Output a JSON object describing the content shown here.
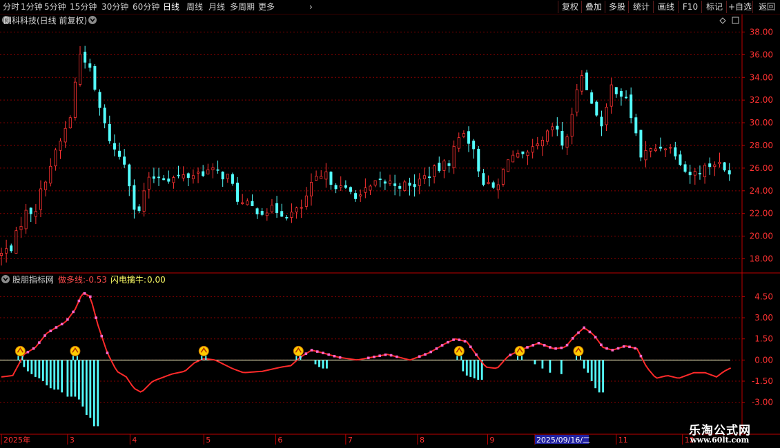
{
  "toolbar": {
    "periods": [
      "分时",
      "1分钟",
      "5分钟",
      "15分钟",
      "30分钟",
      "60分钟",
      "日线",
      "周线",
      "月线",
      "多周期",
      "更多"
    ],
    "active_period": "日线",
    "more_arrow": "›",
    "buttons": [
      "复权",
      "叠加",
      "多股",
      "统计",
      "画线",
      "F10",
      "标记",
      "+自选",
      "返回"
    ]
  },
  "main_panel": {
    "title": "朗科科技(日线 前复权)",
    "collapse_icon": "chevron-down-icon",
    "diamond_icon": "diamond-icon",
    "y_labels": [
      "38.00",
      "36.00",
      "34.00",
      "32.00",
      "30.00",
      "28.00",
      "26.00",
      "24.00",
      "22.00",
      "20.00",
      "18.00"
    ]
  },
  "indicator_panel": {
    "name": "股朋指标网",
    "line1_label": "做多线",
    "line1_value": "-0.53",
    "line2_label": "闪电擒牛",
    "line2_value": "0.00",
    "y_labels": [
      "4.50",
      "3.00",
      "1.50",
      "0.00",
      "-1.50",
      "-3.00"
    ]
  },
  "x_axis": {
    "labels": [
      "2025年",
      "3",
      "4",
      "5",
      "6",
      "7",
      "8",
      "9",
      "2025/09/16/二",
      "11",
      "12"
    ]
  },
  "watermark": {
    "line1": "乐淘公式网",
    "line2": "www.60lt.com"
  },
  "colors": {
    "up": "#ff3232",
    "down": "#54ffff",
    "grid": "#8a0000",
    "axis": "#c00000",
    "signal_line": "#ff2a2a",
    "signal_dot": "#ff66cc",
    "zero_line": "#ffffcc",
    "signal_icon": "#ffcc00",
    "label_red": "#ff4a4a",
    "label_yellow": "#ffff66"
  },
  "chart_data": [
    {
      "type": "candlestick",
      "title": "朗科科技(日线 前复权)",
      "ylim": [
        17,
        39
      ],
      "y_ticks": [
        18,
        20,
        22,
        24,
        26,
        28,
        30,
        32,
        34,
        36,
        38
      ],
      "x_ticks": [
        "2025年",
        "3",
        "4",
        "5",
        "6",
        "7",
        "8",
        "9",
        "2025/09/16/二",
        "11",
        "12"
      ],
      "x_tick_days": [
        0,
        35,
        68,
        107,
        145,
        182,
        220,
        257,
        282,
        325,
        360
      ],
      "anchors": [
        {
          "day": 0,
          "close": 18.4
        },
        {
          "day": 6,
          "close": 19.2
        },
        {
          "day": 12,
          "close": 22.0
        },
        {
          "day": 18,
          "close": 22.4
        },
        {
          "day": 24,
          "close": 25.5
        },
        {
          "day": 30,
          "close": 27.8
        },
        {
          "day": 34,
          "close": 29.5
        },
        {
          "day": 37,
          "close": 30.8
        },
        {
          "day": 38,
          "close": 29.0
        },
        {
          "day": 39,
          "close": 33.5
        },
        {
          "day": 42,
          "close": 36.5
        },
        {
          "day": 46,
          "close": 35.0
        },
        {
          "day": 51,
          "close": 31.8
        },
        {
          "day": 55,
          "close": 29.5
        },
        {
          "day": 60,
          "close": 27.5
        },
        {
          "day": 66,
          "close": 26.4
        },
        {
          "day": 70,
          "close": 22.6
        },
        {
          "day": 73,
          "close": 22.0
        },
        {
          "day": 76,
          "close": 24.5
        },
        {
          "day": 82,
          "close": 25.4
        },
        {
          "day": 90,
          "close": 25.1
        },
        {
          "day": 98,
          "close": 25.3
        },
        {
          "day": 108,
          "close": 25.8
        },
        {
          "day": 114,
          "close": 25.6
        },
        {
          "day": 120,
          "close": 25.2
        },
        {
          "day": 126,
          "close": 22.9
        },
        {
          "day": 136,
          "close": 22.3
        },
        {
          "day": 145,
          "close": 22.3
        },
        {
          "day": 152,
          "close": 21.9
        },
        {
          "day": 158,
          "close": 22.3
        },
        {
          "day": 165,
          "close": 24.8
        },
        {
          "day": 172,
          "close": 25.3
        },
        {
          "day": 180,
          "close": 24.1
        },
        {
          "day": 190,
          "close": 23.6
        },
        {
          "day": 200,
          "close": 24.8
        },
        {
          "day": 210,
          "close": 24.6
        },
        {
          "day": 216,
          "close": 24.3
        },
        {
          "day": 226,
          "close": 25.5
        },
        {
          "day": 236,
          "close": 26.4
        },
        {
          "day": 244,
          "close": 29.5
        },
        {
          "day": 248,
          "close": 28.2
        },
        {
          "day": 252,
          "close": 26.1
        },
        {
          "day": 256,
          "close": 24.4
        },
        {
          "day": 262,
          "close": 24.1
        },
        {
          "day": 268,
          "close": 27.2
        },
        {
          "day": 276,
          "close": 26.8
        },
        {
          "day": 286,
          "close": 28.2
        },
        {
          "day": 292,
          "close": 29.8
        },
        {
          "day": 297,
          "close": 27.8
        },
        {
          "day": 302,
          "close": 30.6
        },
        {
          "day": 306,
          "close": 35.2
        },
        {
          "day": 310,
          "close": 32.3
        },
        {
          "day": 314,
          "close": 31.3
        },
        {
          "day": 318,
          "close": 29.2
        },
        {
          "day": 322,
          "close": 33.2
        },
        {
          "day": 326,
          "close": 32.9
        },
        {
          "day": 330,
          "close": 32.0
        },
        {
          "day": 334,
          "close": 30.0
        },
        {
          "day": 338,
          "close": 27.1
        },
        {
          "day": 343,
          "close": 27.5
        },
        {
          "day": 350,
          "close": 28.1
        },
        {
          "day": 357,
          "close": 27.4
        },
        {
          "day": 362,
          "close": 25.6
        },
        {
          "day": 366,
          "close": 25.5
        },
        {
          "day": 372,
          "close": 26.1
        },
        {
          "day": 378,
          "close": 26.6
        },
        {
          "day": 382,
          "close": 25.7
        },
        {
          "day": 385,
          "close": 25.9
        }
      ]
    },
    {
      "type": "line+bar",
      "title": "股朋指标网",
      "ylim": [
        -3.8,
        5.4
      ],
      "y_ticks": [
        4.5,
        3.0,
        1.5,
        0.0,
        -1.5,
        -3.0
      ],
      "series": [
        {
          "name": "做多线",
          "last_value": -0.53,
          "anchors": [
            {
              "day": 0,
              "v": -1.2
            },
            {
              "day": 6,
              "v": -1.1
            },
            {
              "day": 12,
              "v": 0.4
            },
            {
              "day": 18,
              "v": 0.9
            },
            {
              "day": 24,
              "v": 1.9
            },
            {
              "day": 30,
              "v": 2.4
            },
            {
              "day": 34,
              "v": 2.7
            },
            {
              "day": 39,
              "v": 3.6
            },
            {
              "day": 43,
              "v": 4.8
            },
            {
              "day": 47,
              "v": 4.5
            },
            {
              "day": 51,
              "v": 2.5
            },
            {
              "day": 56,
              "v": 0.5
            },
            {
              "day": 61,
              "v": -0.8
            },
            {
              "day": 66,
              "v": -1.2
            },
            {
              "day": 70,
              "v": -2.0
            },
            {
              "day": 74,
              "v": -2.3
            },
            {
              "day": 80,
              "v": -1.5
            },
            {
              "day": 90,
              "v": -1.0
            },
            {
              "day": 97,
              "v": -0.8
            },
            {
              "day": 102,
              "v": -0.2
            },
            {
              "day": 107,
              "v": 0.1
            },
            {
              "day": 113,
              "v": 0.0
            },
            {
              "day": 122,
              "v": -0.6
            },
            {
              "day": 128,
              "v": -0.9
            },
            {
              "day": 138,
              "v": -0.8
            },
            {
              "day": 148,
              "v": -0.5
            },
            {
              "day": 153,
              "v": -0.4
            },
            {
              "day": 158,
              "v": 0.2
            },
            {
              "day": 164,
              "v": 0.7
            },
            {
              "day": 170,
              "v": 0.5
            },
            {
              "day": 178,
              "v": 0.2
            },
            {
              "day": 188,
              "v": 0.0
            },
            {
              "day": 196,
              "v": 0.2
            },
            {
              "day": 204,
              "v": 0.4
            },
            {
              "day": 210,
              "v": 0.2
            },
            {
              "day": 216,
              "v": 0.0
            },
            {
              "day": 226,
              "v": 0.5
            },
            {
              "day": 235,
              "v": 1.2
            },
            {
              "day": 240,
              "v": 1.5
            },
            {
              "day": 246,
              "v": 1.3
            },
            {
              "day": 252,
              "v": 0.2
            },
            {
              "day": 256,
              "v": -0.5
            },
            {
              "day": 262,
              "v": -0.6
            },
            {
              "day": 268,
              "v": 0.3
            },
            {
              "day": 276,
              "v": 0.8
            },
            {
              "day": 284,
              "v": 1.2
            },
            {
              "day": 292,
              "v": 0.8
            },
            {
              "day": 298,
              "v": 0.9
            },
            {
              "day": 303,
              "v": 1.7
            },
            {
              "day": 308,
              "v": 2.3
            },
            {
              "day": 313,
              "v": 1.8
            },
            {
              "day": 318,
              "v": 0.9
            },
            {
              "day": 323,
              "v": 0.7
            },
            {
              "day": 330,
              "v": 1.0
            },
            {
              "day": 336,
              "v": 0.8
            },
            {
              "day": 341,
              "v": -0.5
            },
            {
              "day": 346,
              "v": -1.3
            },
            {
              "day": 352,
              "v": -1.1
            },
            {
              "day": 358,
              "v": -1.3
            },
            {
              "day": 366,
              "v": -0.9
            },
            {
              "day": 372,
              "v": -0.9
            },
            {
              "day": 378,
              "v": -1.2
            },
            {
              "day": 382,
              "v": -0.8
            },
            {
              "day": 386,
              "v": -0.53
            }
          ]
        },
        {
          "name": "闪电擒牛",
          "last_value": 0.0
        }
      ],
      "bars": [
        {
          "day": 10,
          "v": -0.2
        },
        {
          "day": 12,
          "v": -0.5
        },
        {
          "day": 14,
          "v": -0.8
        },
        {
          "day": 16,
          "v": -1.0
        },
        {
          "day": 18,
          "v": -1.2
        },
        {
          "day": 20,
          "v": -1.3
        },
        {
          "day": 22,
          "v": -1.5
        },
        {
          "day": 24,
          "v": -1.8
        },
        {
          "day": 26,
          "v": -2.0
        },
        {
          "day": 28,
          "v": -2.1
        },
        {
          "day": 30,
          "v": -2.1
        },
        {
          "day": 32,
          "v": -2.3
        },
        {
          "day": 35,
          "v": -2.6
        },
        {
          "day": 37,
          "v": -2.6
        },
        {
          "day": 39,
          "v": -2.6
        },
        {
          "day": 41,
          "v": -2.8
        },
        {
          "day": 43,
          "v": -3.3
        },
        {
          "day": 45,
          "v": -3.9
        },
        {
          "day": 47,
          "v": -4.1
        },
        {
          "day": 49,
          "v": -4.7
        },
        {
          "day": 51,
          "v": -4.7
        },
        {
          "day": 166,
          "v": -0.3
        },
        {
          "day": 168,
          "v": -0.5
        },
        {
          "day": 170,
          "v": -0.6
        },
        {
          "day": 172,
          "v": -0.6
        },
        {
          "day": 244,
          "v": -0.8
        },
        {
          "day": 246,
          "v": -1.1
        },
        {
          "day": 248,
          "v": -1.2
        },
        {
          "day": 250,
          "v": -1.3
        },
        {
          "day": 252,
          "v": -1.4
        },
        {
          "day": 254,
          "v": -1.4
        },
        {
          "day": 282,
          "v": -0.3
        },
        {
          "day": 286,
          "v": -0.6
        },
        {
          "day": 290,
          "v": -0.9
        },
        {
          "day": 296,
          "v": -1.0
        },
        {
          "day": 308,
          "v": -0.6
        },
        {
          "day": 310,
          "v": -0.9
        },
        {
          "day": 312,
          "v": -1.5
        },
        {
          "day": 314,
          "v": -2.0
        },
        {
          "day": 316,
          "v": -2.3
        },
        {
          "day": 318,
          "v": -2.3
        }
      ],
      "signals_days": [
        10,
        39,
        107,
        157,
        242,
        274,
        305
      ]
    }
  ]
}
